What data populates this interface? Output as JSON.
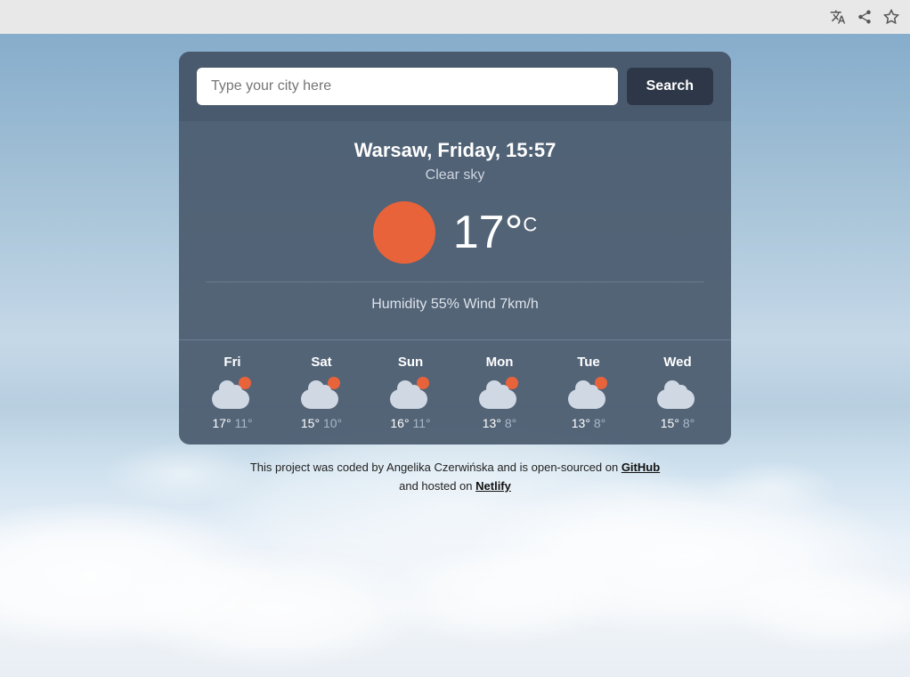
{
  "browser": {
    "translate_icon": "🌐",
    "share_icon": "⬆",
    "star_icon": "☆"
  },
  "search": {
    "placeholder": "Type your city here",
    "button_label": "Search"
  },
  "weather": {
    "location": "Warsaw, Friday, 15:57",
    "description": "Clear sky",
    "temperature": "17°",
    "temp_unit": "C",
    "humidity_wind": "Humidity 55% Wind 7km/h",
    "forecast": [
      {
        "day": "Fri",
        "high": "17°",
        "low": "11°"
      },
      {
        "day": "Sat",
        "high": "15°",
        "low": "10°"
      },
      {
        "day": "Sun",
        "high": "16°",
        "low": "11°"
      },
      {
        "day": "Mon",
        "high": "13°",
        "low": "8°"
      },
      {
        "day": "Tue",
        "high": "13°",
        "low": "8°"
      },
      {
        "day": "Wed",
        "high": "15°",
        "low": "8°"
      }
    ]
  },
  "footer": {
    "text_before": "This project was coded by Angelika Czerwińska and is open-sourced on ",
    "github_label": "GitHub",
    "text_middle": " and hosted on ",
    "netlify_label": "Netlify"
  }
}
